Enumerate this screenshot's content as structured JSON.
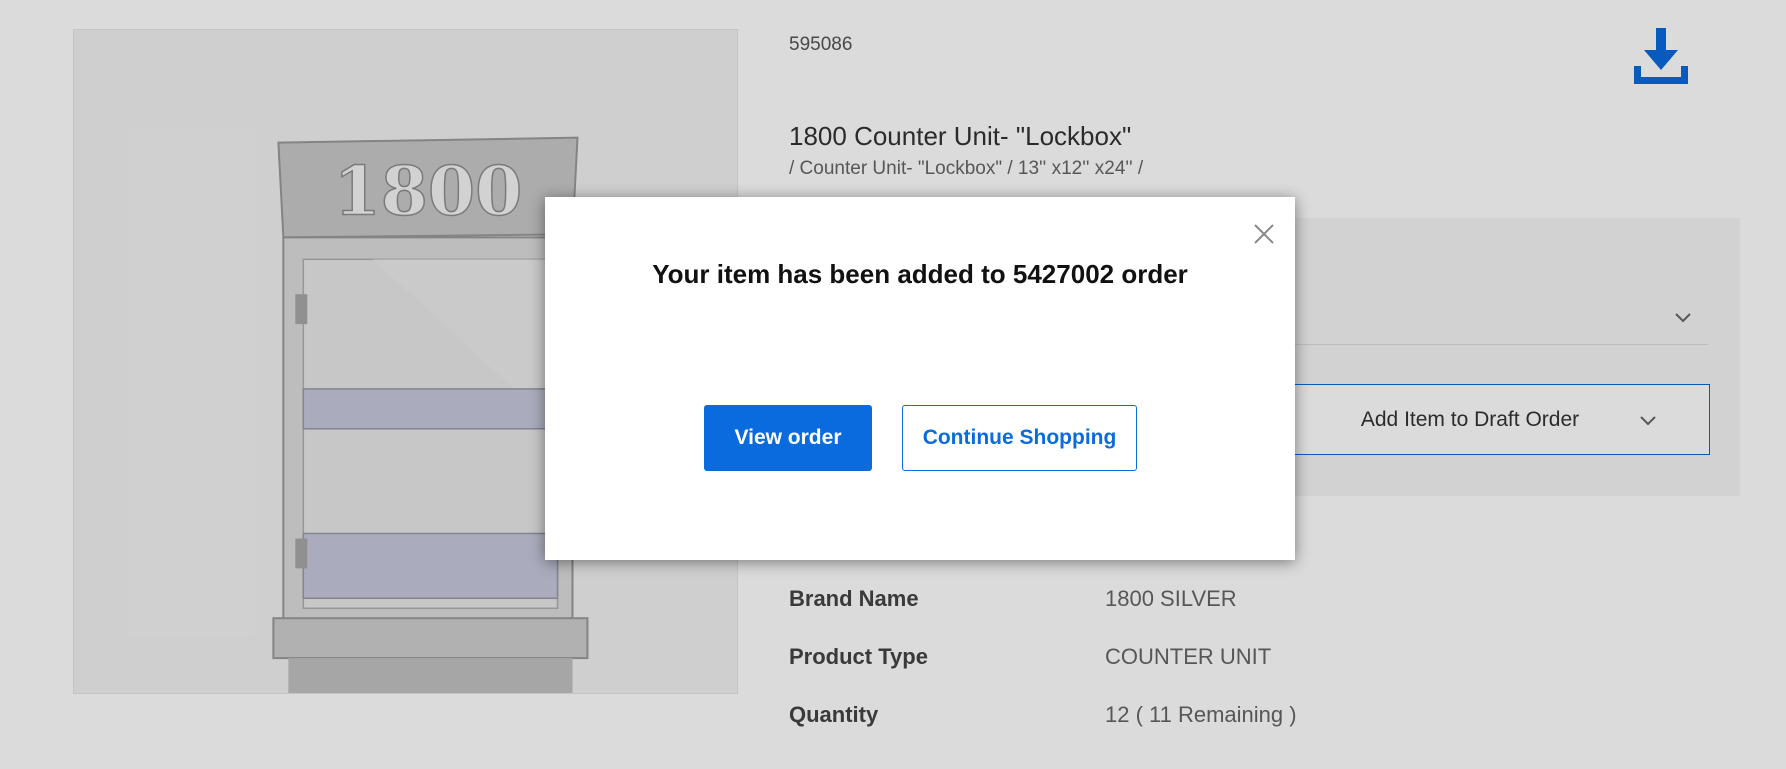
{
  "product": {
    "sku": "595086",
    "title": "1800 Counter Unit- \"Lockbox\"",
    "breadcrumb": "/ Counter Unit- \"Lockbox\" / 13'' x12'' x24'' /",
    "image_alt": "1800 Counter Unit Lockbox",
    "image_sign_text": "1800"
  },
  "order": {
    "add_to_draft_label": "Add Item to Draft Order"
  },
  "details": [
    {
      "key": "Brand Name",
      "value": "1800 SILVER"
    },
    {
      "key": "Product Type",
      "value": "COUNTER UNIT"
    },
    {
      "key": "Quantity",
      "value": "12 ( 11 Remaining )"
    }
  ],
  "modal": {
    "message": "Your item has been added to 5427002 order",
    "view_order_label": "View order",
    "continue_label": "Continue Shopping",
    "close_icon": "close-icon"
  },
  "colors": {
    "primary": "#0a6bde",
    "overlay": "rgba(0,0,0,0.14)"
  }
}
